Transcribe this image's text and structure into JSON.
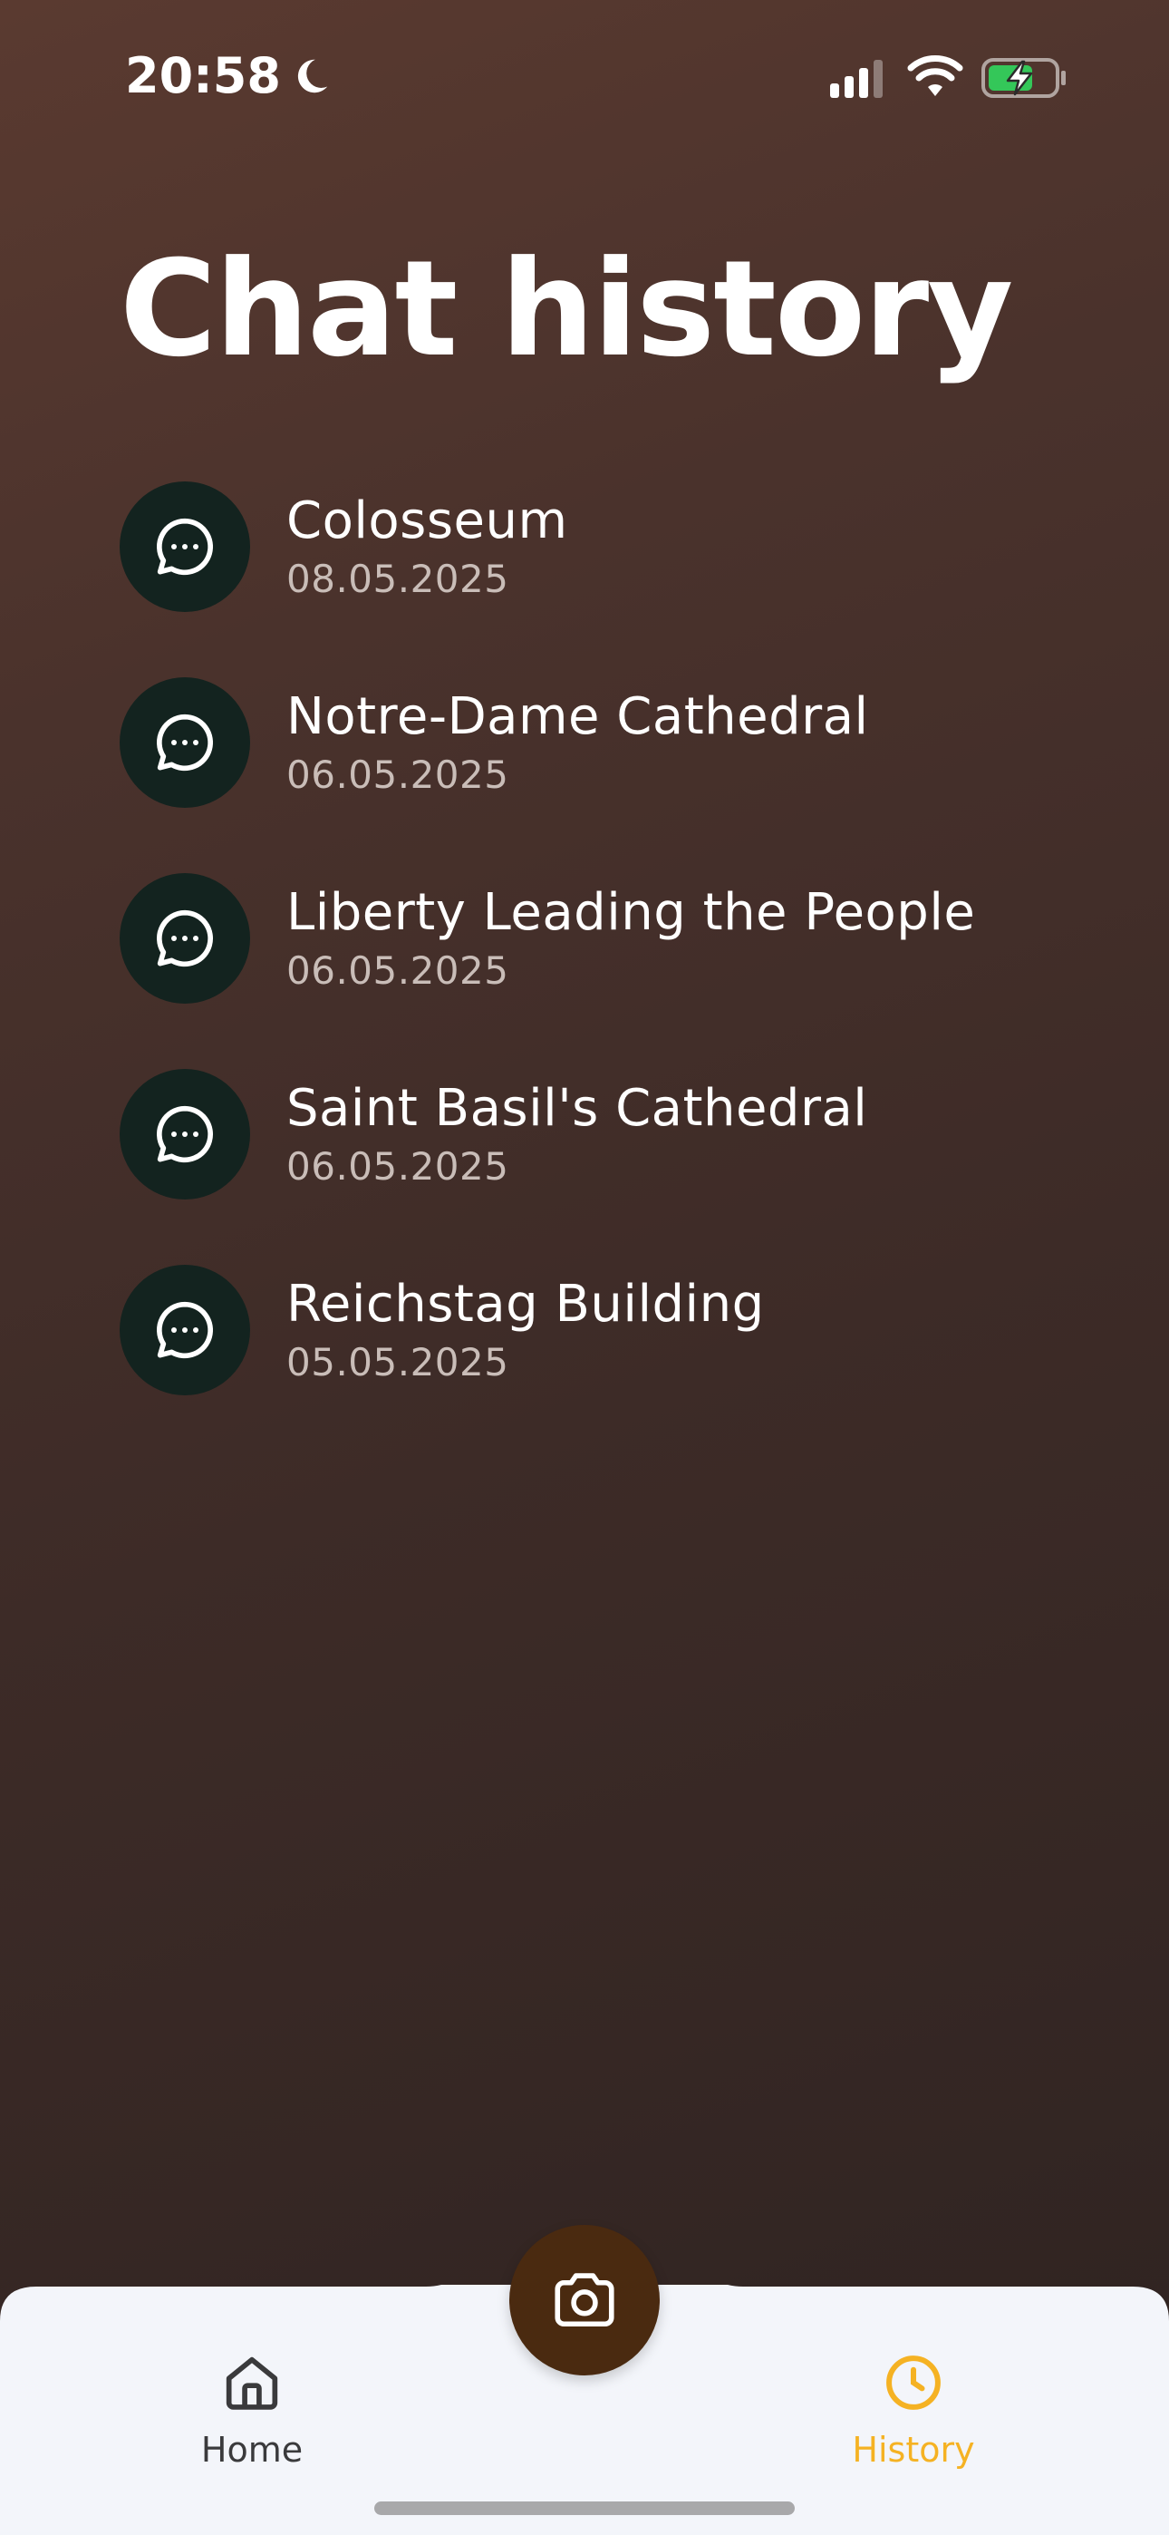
{
  "status_bar": {
    "time": "20:58",
    "icons": [
      "moon-icon",
      "signal-icon",
      "wifi-icon",
      "battery-charging-icon"
    ]
  },
  "page": {
    "title": "Chat history"
  },
  "history": {
    "items": [
      {
        "title": "Colosseum",
        "date": "08.05.2025",
        "icon": "chat-bubble-icon"
      },
      {
        "title": "Notre-Dame Cathedral",
        "date": "06.05.2025",
        "icon": "chat-bubble-icon"
      },
      {
        "title": "Liberty Leading the People",
        "date": "06.05.2025",
        "icon": "chat-bubble-icon"
      },
      {
        "title": "Saint Basil's Cathedral",
        "date": "06.05.2025",
        "icon": "chat-bubble-icon"
      },
      {
        "title": "Reichstag Building",
        "date": "05.05.2025",
        "icon": "chat-bubble-icon"
      }
    ]
  },
  "bottom_nav": {
    "home_label": "Home",
    "history_label": "History",
    "active_tab": "History",
    "center_action_icon": "camera-icon"
  },
  "colors": {
    "accent": "#f5b223",
    "avatar_bg": "#13231f",
    "camera_button": "#4a2a10",
    "nav_bg": "#f3f5fa",
    "battery_fill": "#34c759"
  }
}
